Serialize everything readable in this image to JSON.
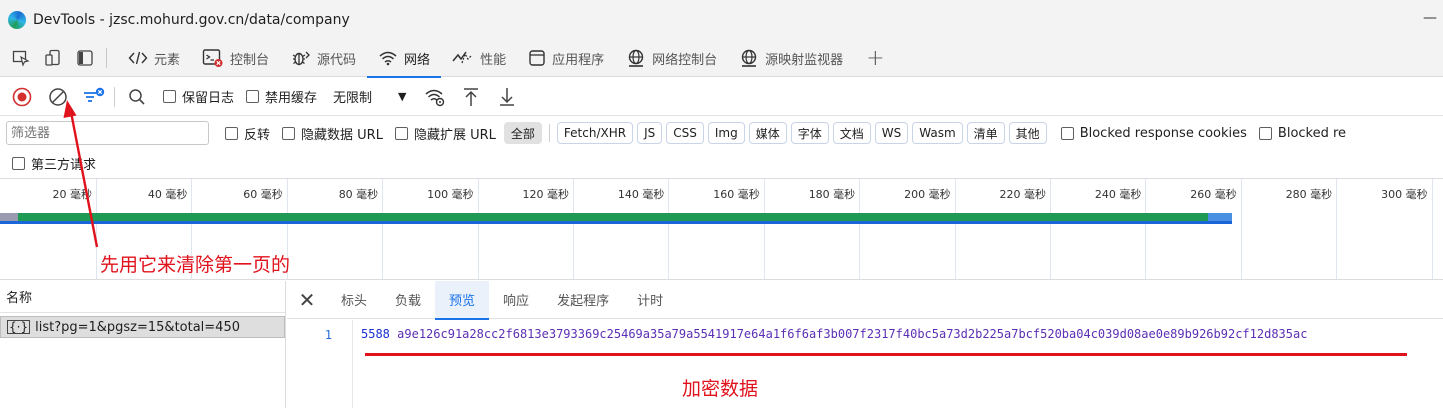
{
  "window": {
    "title": "DevTools - jzsc.mohurd.gov.cn/data/company",
    "minimize": "—"
  },
  "tabs": [
    {
      "label": "元素",
      "icon": "code-icon",
      "active": false
    },
    {
      "label": "控制台",
      "icon": "console-icon",
      "active": false
    },
    {
      "label": "源代码",
      "icon": "bug-icon",
      "active": false
    },
    {
      "label": "网络",
      "icon": "wifi-icon",
      "active": true
    },
    {
      "label": "性能",
      "icon": "performance-icon",
      "active": false
    },
    {
      "label": "应用程序",
      "icon": "application-icon",
      "active": false
    },
    {
      "label": "网络控制台",
      "icon": "globe-icon",
      "active": false
    },
    {
      "label": "源映射监视器",
      "icon": "globe-monitor-icon",
      "active": false
    }
  ],
  "toolbar": {
    "preserve_log": "保留日志",
    "disable_cache": "禁用缓存",
    "throttling": "无限制"
  },
  "filter": {
    "placeholder": "筛选器",
    "invert": "反转",
    "hide_data_urls": "隐藏数据 URL",
    "hide_extension_urls": "隐藏扩展 URL",
    "types": [
      "全部",
      "Fetch/XHR",
      "JS",
      "CSS",
      "Img",
      "媒体",
      "字体",
      "文档",
      "WS",
      "Wasm",
      "清单",
      "其他"
    ],
    "blocked_response_cookies": "Blocked response cookies",
    "blocked_requests": "Blocked re",
    "third_party": "第三方请求"
  },
  "timeline": {
    "ticks": [
      "20 毫秒",
      "40 毫秒",
      "60 毫秒",
      "80 毫秒",
      "100 毫秒",
      "120 毫秒",
      "140 毫秒",
      "160 毫秒",
      "180 毫秒",
      "200 毫秒",
      "220 毫秒",
      "240 毫秒",
      "260 毫秒",
      "280 毫秒",
      "300 毫秒"
    ]
  },
  "requests": {
    "column_name": "名称",
    "items": [
      {
        "name": "list?pg=1&pgsz=15&total=450",
        "icon": "json-icon"
      }
    ]
  },
  "detail": {
    "tabs": [
      "标头",
      "负载",
      "预览",
      "响应",
      "发起程序",
      "计时"
    ],
    "active_tab": "预览",
    "line_number": "1",
    "code_num": "5588",
    "code_rest": "a9e126c91a28cc2f6813e3793369c25469a35a79a5541917e64a1f6f6af3b007f2317f40bc5a73d2b225a7bcf520ba04c039d08ae0e89b926b92cf12d835ac"
  },
  "annotations": {
    "clear_note": "先用它来清除第一页的",
    "encrypted_note": "加密数据",
    "color": "#e0121c"
  },
  "colors": {
    "accent": "#1a73e8",
    "record_red": "#d32f2f",
    "waterfall_green": "#1e9a55"
  }
}
